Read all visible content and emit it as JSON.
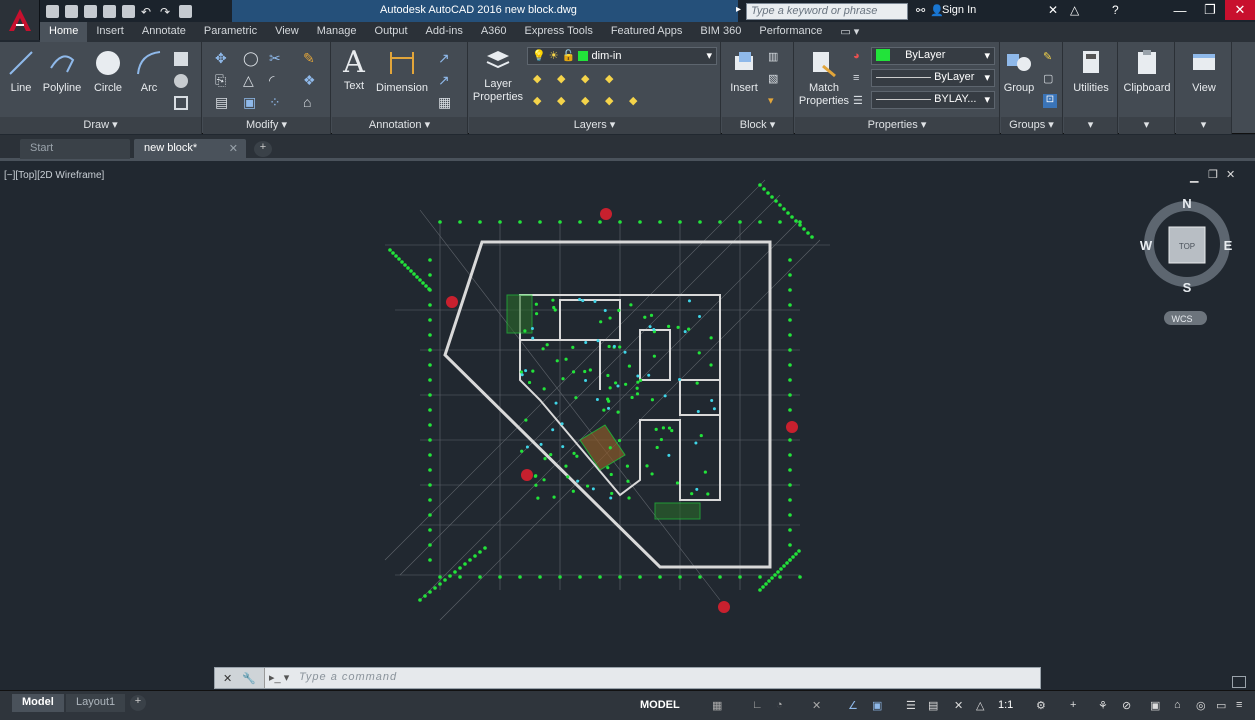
{
  "titlebar": {
    "title": "Autodesk AutoCAD 2016    new block.dwg",
    "search_placeholder": "Type a keyword or phrase",
    "signin": "Sign In"
  },
  "tabs": [
    "Home",
    "Insert",
    "Annotate",
    "Parametric",
    "View",
    "Manage",
    "Output",
    "Add-ins",
    "A360",
    "Express Tools",
    "Featured Apps",
    "BIM 360",
    "Performance"
  ],
  "ribbon": {
    "draw": {
      "title": "Draw",
      "line": "Line",
      "polyline": "Polyline",
      "circle": "Circle",
      "arc": "Arc"
    },
    "modify": {
      "title": "Modify"
    },
    "annotation": {
      "title": "Annotation",
      "text": "Text",
      "dimension": "Dimension"
    },
    "layers": {
      "title": "Layers",
      "layer_props_1": "Layer",
      "layer_props_2": "Properties",
      "current_layer": "dim-in"
    },
    "block": {
      "title": "Block",
      "insert": "Insert"
    },
    "properties": {
      "title": "Properties",
      "match_1": "Match",
      "match_2": "Properties",
      "color": "ByLayer",
      "linetype": "ByLayer",
      "lineweight": "BYLAY..."
    },
    "groups": {
      "title": "Groups",
      "group": "Group"
    },
    "utilities": "Utilities",
    "clipboard": "Clipboard",
    "view": "View"
  },
  "doc_tabs": [
    "Start",
    "new block*"
  ],
  "viewport": {
    "label": "[−][Top][2D Wireframe]",
    "compass": {
      "n": "N",
      "s": "S",
      "e": "E",
      "w": "W",
      "top": "TOP",
      "wcs": "WCS"
    }
  },
  "command": {
    "placeholder": "Type a command"
  },
  "status": {
    "layout_tabs": [
      "Model",
      "Layout1"
    ],
    "model": "MODEL",
    "scale": "1:1"
  },
  "colors": {
    "accent": "#c8102e",
    "drawing_green": "#22e33a",
    "walls": "#d9d9d9",
    "cyan": "#3fd6e8"
  }
}
